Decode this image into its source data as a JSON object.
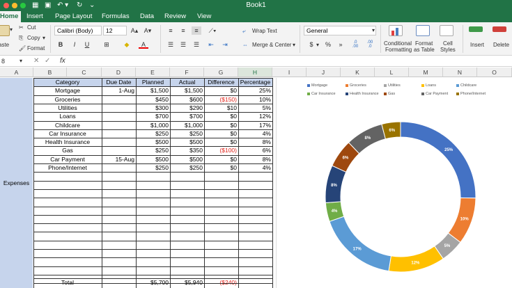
{
  "window": {
    "title": "Book1"
  },
  "tabs": [
    "Home",
    "Insert",
    "Page Layout",
    "Formulas",
    "Data",
    "Review",
    "View"
  ],
  "ribbon": {
    "cut": "Cut",
    "copy": "Copy",
    "format": "Format",
    "paste": "aste",
    "font": "Calibri (Body)",
    "size": "12",
    "bold": "B",
    "italic": "I",
    "underline": "U",
    "wrap_text": "Wrap Text",
    "merge_center": "Merge & Center",
    "number_format": "General",
    "currency": "$",
    "percent": "%",
    "comma": "»",
    "dec_inc": ".0\n.00",
    "dec_dec": ".00\n.0",
    "conditional": "Conditional",
    "conditional2": "Formatting",
    "format_table": "Format",
    "format_table2": "as Table",
    "cell_styles": "Cell",
    "cell_styles2": "Styles",
    "insert": "Insert",
    "delete": "Delete"
  },
  "formula_bar": {
    "cell_ref": "8",
    "fx": "fx",
    "value": ""
  },
  "columns": [
    "A",
    "B",
    "C",
    "D",
    "E",
    "F",
    "G",
    "H",
    "I",
    "J",
    "K",
    "L",
    "M",
    "N",
    "O"
  ],
  "sheet": {
    "side_label": "Expenses",
    "headers": [
      "Category",
      "Due Date",
      "Planned",
      "Actual",
      "Difference",
      "Percentage"
    ],
    "rows": [
      [
        "Mortgage",
        "1-Aug",
        "$1,500",
        "$1,500",
        "$0",
        "25%"
      ],
      [
        "Groceries",
        "",
        "$450",
        "$600",
        "($150)",
        "10%"
      ],
      [
        "Utilities",
        "",
        "$300",
        "$290",
        "$10",
        "5%"
      ],
      [
        "Loans",
        "",
        "$700",
        "$700",
        "$0",
        "12%"
      ],
      [
        "Childcare",
        "",
        "$1,000",
        "$1,000",
        "$0",
        "17%"
      ],
      [
        "Car Insurance",
        "",
        "$250",
        "$250",
        "$0",
        "4%"
      ],
      [
        "Health Insurance",
        "",
        "$500",
        "$500",
        "$0",
        "8%"
      ],
      [
        "Gas",
        "",
        "$250",
        "$350",
        "($100)",
        "6%"
      ],
      [
        "Car Payment",
        "15-Aug",
        "$500",
        "$500",
        "$0",
        "8%"
      ],
      [
        "Phone/Internet",
        "",
        "$250",
        "$250",
        "$0",
        "4%"
      ]
    ],
    "total": [
      "Total",
      "",
      "$5,700",
      "$5,940",
      "($240)",
      ""
    ]
  },
  "chart_data": {
    "type": "pie",
    "legend": [
      "Mortgage",
      "Groceries",
      "Utilities",
      "Loans",
      "Childcare",
      "Car Insurance",
      "Health Insurance",
      "Gas",
      "Car Payment",
      "Phone/Internet"
    ],
    "values": [
      25,
      10,
      5,
      12,
      17,
      4,
      8,
      6,
      8,
      4
    ],
    "labels": [
      "25%",
      "10%",
      "5%",
      "12%",
      "17%",
      "4%",
      "8%",
      "6%",
      "8%",
      "6%"
    ],
    "colors": [
      "#4472c4",
      "#ed7d31",
      "#a5a5a5",
      "#ffc000",
      "#5b9bd5",
      "#70ad47",
      "#264478",
      "#9e480e",
      "#636363",
      "#997300"
    ],
    "donut": true,
    "legend_position": "top"
  }
}
